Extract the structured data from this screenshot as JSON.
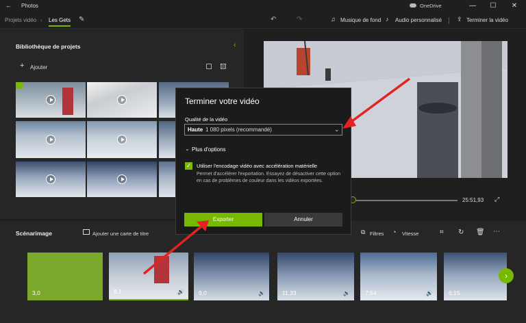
{
  "window": {
    "title": "Photos",
    "onedrive": "OneDrive",
    "minimize": "—",
    "maximize": "☐",
    "close": "✕"
  },
  "breadcrumb": {
    "root": "Projets vidéo",
    "current": "Les Gets"
  },
  "toolbar": {
    "music": "Musique de fond",
    "audio": "Audio personnalisé",
    "finish": "Terminer la vidéo"
  },
  "library": {
    "title": "Bibliothèque de projets",
    "add": "Ajouter"
  },
  "player": {
    "time": "25:51,93"
  },
  "storyboard": {
    "title": "Scénarimage",
    "add_title_card": "Ajouter une carte de titre",
    "filters": "Filtres",
    "speed": "Vitesse",
    "clips": [
      {
        "duration": "3,0"
      },
      {
        "duration": "8,1"
      },
      {
        "duration": "9,0"
      },
      {
        "duration": "11,33"
      },
      {
        "duration": "7:54"
      },
      {
        "duration": "6:15"
      }
    ]
  },
  "dialog": {
    "title": "Terminer votre vidéo",
    "quality_label": "Qualité de la vidéo",
    "quality_bold": "Haute",
    "quality_rest": " 1 080 pixels (recommandé)",
    "more_options": "Plus d'options",
    "hw_encoding": "Utiliser l'encodage vidéo avec accélération matérielle",
    "hw_desc": "Permet d'accélérer l'exportation. Essayez de désactiver cette option en cas de problèmes de couleur dans les vidéos exportées.",
    "export": "Exporter",
    "cancel": "Annuler"
  },
  "colors": {
    "accent": "#76b900",
    "arrow": "#e32222"
  }
}
